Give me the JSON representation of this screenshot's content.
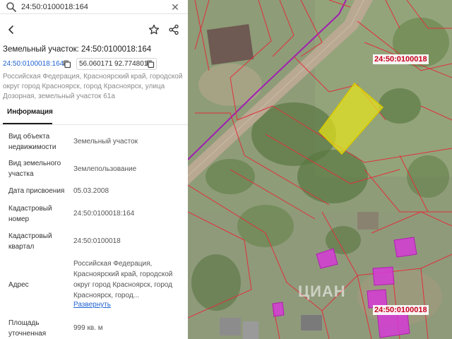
{
  "search": {
    "value": "24:50:0100018:164",
    "icon": "search-icon",
    "clear_icon": "close-icon"
  },
  "header": {
    "back_icon": "arrow-left-icon",
    "favorite_icon": "star-outline-icon",
    "share_icon": "share-icon"
  },
  "title": "Земельный участок: 24:50:0100018:164",
  "cadastral_id": "24:50:0100018:164",
  "coords": "56.060171 92.774801",
  "address_top": "Российская Федерация, Красноярский край, городской округ город Красноярск, город Красноярск, улица Дозорная, земельный участок 61а",
  "tabs": [
    {
      "label": "Информация",
      "active": true
    }
  ],
  "info": [
    {
      "label": "Вид объекта недвижимости",
      "value": "Земельный участок"
    },
    {
      "label": "Вид земельного участка",
      "value": "Землепользование"
    },
    {
      "label": "Дата присвоения",
      "value": "05.03.2008"
    },
    {
      "label": "Кадастровый номер",
      "value": "24:50:0100018:164"
    },
    {
      "label": "Кадастровый квартал",
      "value": "24:50:0100018"
    },
    {
      "label": "Адрес",
      "value": "Российская Федерация, Красноярский край, городской округ город Красноярск, город Красноярск, город..."
    },
    {
      "label": "Площадь уточненная",
      "value": "999 кв. м"
    }
  ],
  "expand_label": "Развернуть",
  "map": {
    "quarter_label_top": "24:50:0100018",
    "quarter_label_bottom": "24:50:0100018",
    "watermark": "ЦИАН",
    "colors": {
      "boundary": "#e0303a",
      "selected_fill": "#e8e61a",
      "building_fill": "#d63ad6",
      "purple_line": "#a020b0"
    }
  }
}
